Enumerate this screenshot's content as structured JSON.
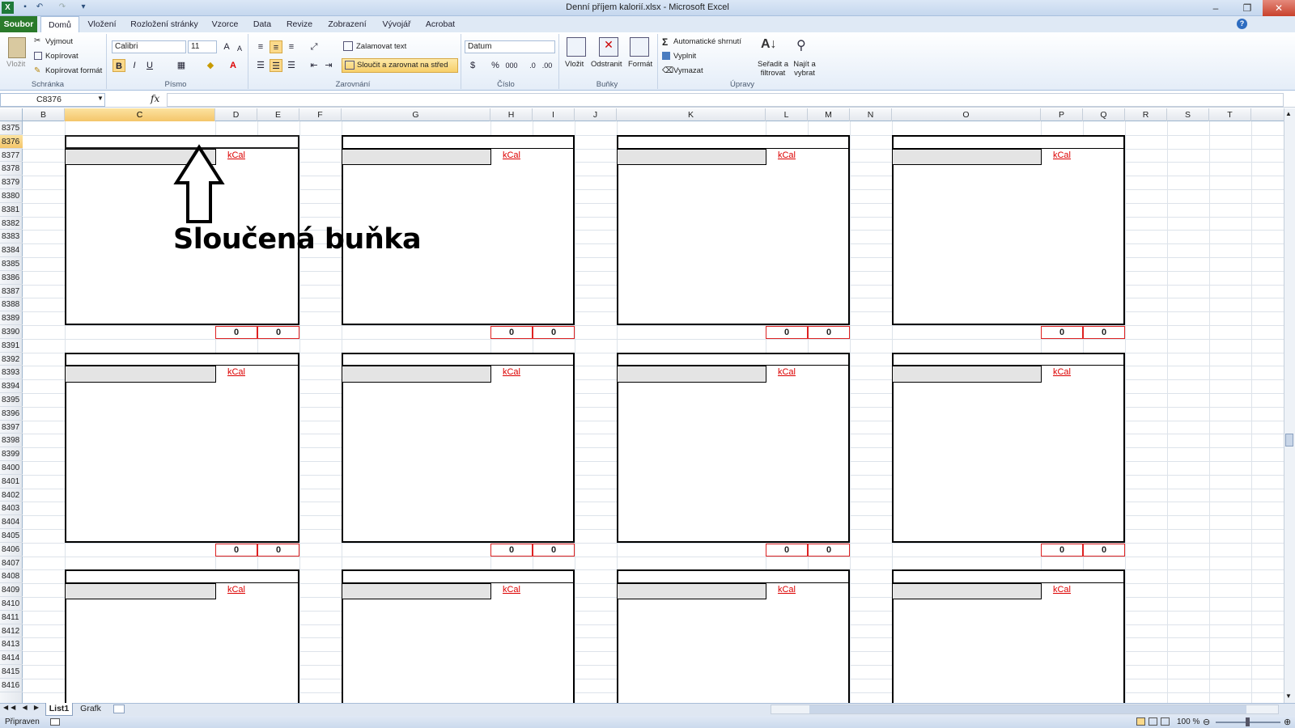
{
  "window": {
    "title": "Denní příjem kalorií.xlsx  -  Microsoft Excel",
    "app_icon": "excel-icon"
  },
  "tabs": [
    {
      "label": "Soubor"
    },
    {
      "label": "Domů"
    },
    {
      "label": "Vložení"
    },
    {
      "label": "Rozložení stránky"
    },
    {
      "label": "Vzorce"
    },
    {
      "label": "Data"
    },
    {
      "label": "Revize"
    },
    {
      "label": "Zobrazení"
    },
    {
      "label": "Vývojář"
    },
    {
      "label": "Acrobat"
    }
  ],
  "ribbon": {
    "clipboard": {
      "paste": "Vložit",
      "cut": "Vyjmout",
      "copy": "Kopírovat",
      "format_painter": "Kopírovat formát",
      "group": "Schránka"
    },
    "font": {
      "name": "Calibri",
      "size": "11",
      "group": "Písmo",
      "bold": "B",
      "italic": "I",
      "underline": "U"
    },
    "alignment": {
      "wrap": "Zalamovat text",
      "merge": "Sloučit a zarovnat na střed",
      "group": "Zarovnání"
    },
    "number": {
      "format": "Datum",
      "percent": "%",
      "thousands": "000",
      "group": "Číslo"
    },
    "cells": {
      "insert": "Vložit",
      "delete": "Odstranit",
      "format": "Formát",
      "group": "Buňky"
    },
    "editing": {
      "autosum": "Automatické shrnutí",
      "fill": "Vyplnit",
      "clear": "Vymazat",
      "sort": "Seřadit a filtrovat",
      "find": "Najít a vybrat",
      "group": "Úpravy"
    }
  },
  "formula_bar": {
    "name_box": "C8376",
    "fx": "fx",
    "formula": ""
  },
  "columns": [
    "B",
    "C",
    "D",
    "E",
    "F",
    "G",
    "H",
    "I",
    "J",
    "K",
    "L",
    "M",
    "N",
    "O",
    "P",
    "Q",
    "R",
    "S",
    "T"
  ],
  "rows": [
    "8375",
    "8376",
    "8377",
    "8378",
    "8379",
    "8380",
    "8381",
    "8382",
    "8383",
    "8384",
    "8385",
    "8386",
    "8387",
    "8388",
    "8389",
    "8390",
    "8391",
    "8392",
    "8393",
    "8394",
    "8395",
    "8396",
    "8397",
    "8398",
    "8399",
    "8400",
    "8401",
    "8402",
    "8403",
    "8404",
    "8405",
    "8406",
    "8407",
    "8408",
    "8409",
    "8410",
    "8411",
    "8412",
    "8413",
    "8414",
    "8415",
    "8416"
  ],
  "selected_cell": {
    "column": "C",
    "row": "8376"
  },
  "sheet": {
    "kcal_label": "kCal",
    "zero_value": "0"
  },
  "annotation": {
    "label": "Sloučená buňka"
  },
  "sheet_tabs": [
    {
      "label": "List1"
    },
    {
      "label": "Grafk"
    }
  ],
  "status": {
    "ready": "Připraven",
    "zoom": "100 %"
  }
}
